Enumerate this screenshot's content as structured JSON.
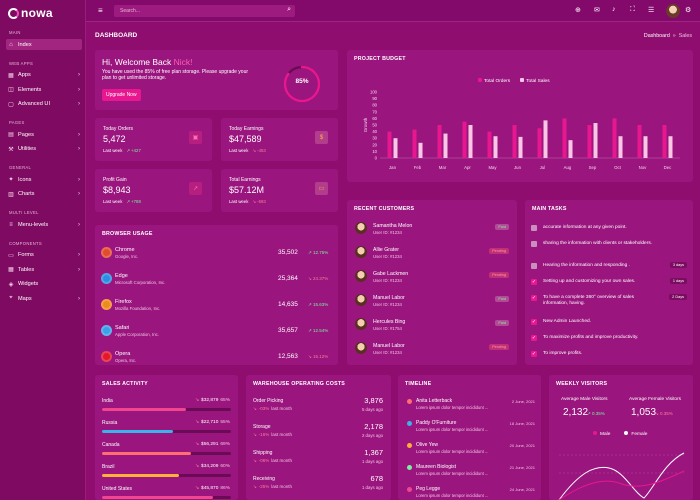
{
  "app": {
    "name": "nowa"
  },
  "sidebar": {
    "sections": [
      {
        "title": "MAIN",
        "items": [
          {
            "label": "Index",
            "icon": "home-icon",
            "chevron": false,
            "active": true
          }
        ]
      },
      {
        "title": "WEB APPS",
        "items": [
          {
            "label": "Apps",
            "icon": "grid-icon",
            "chevron": true
          },
          {
            "label": "Elements",
            "icon": "layers-icon",
            "chevron": true
          },
          {
            "label": "Advanced UI",
            "icon": "box-icon",
            "chevron": true
          }
        ]
      },
      {
        "title": "PAGES",
        "items": [
          {
            "label": "Pages",
            "icon": "pages-icon",
            "chevron": true
          },
          {
            "label": "Utilities",
            "icon": "tools-icon",
            "chevron": true
          }
        ]
      },
      {
        "title": "GENERAL",
        "items": [
          {
            "label": "Icons",
            "icon": "icons-icon",
            "chevron": true
          },
          {
            "label": "Charts",
            "icon": "chart-icon",
            "chevron": true
          }
        ]
      },
      {
        "title": "MULTI LEVEL",
        "items": [
          {
            "label": "Menu-levels",
            "icon": "menu-icon",
            "chevron": true
          }
        ]
      },
      {
        "title": "COMPONENTS",
        "items": [
          {
            "label": "Forms",
            "icon": "forms-icon",
            "chevron": true
          },
          {
            "label": "Tables",
            "icon": "table-icon",
            "chevron": true
          },
          {
            "label": "Widgets",
            "icon": "widget-icon",
            "chevron": false
          },
          {
            "label": "Maps",
            "icon": "map-icon",
            "chevron": true
          }
        ]
      }
    ]
  },
  "header": {
    "search_placeholder": "Search..."
  },
  "page": {
    "title": "DASHBOARD",
    "breadcrumb_home": "Dashboard",
    "breadcrumb_sep": "»",
    "breadcrumb_current": "Sales"
  },
  "welcome": {
    "greeting": "Hi, Welcome Back ",
    "name": "Nick!",
    "text": "You have used the 85% of free plan storage. Please upgrade your plan to get unlimited storage.",
    "button": "Upgrade Now",
    "percent": "85%",
    "percent_value": 85
  },
  "stats": [
    {
      "label": "Today Orders",
      "value": "5,472",
      "period": "Last week",
      "change": "+427",
      "up": true,
      "icon": "orders-icon"
    },
    {
      "label": "Today Earnings",
      "value": "$47,589",
      "period": "Last week",
      "change": "-453",
      "up": false,
      "icon": "earnings-icon"
    },
    {
      "label": "Profit Gain",
      "value": "$8,943",
      "period": "Last week",
      "change": "+788",
      "up": true,
      "icon": "profit-icon"
    },
    {
      "label": "Total Earnings",
      "value": "$57.12M",
      "period": "Last week",
      "change": "-693",
      "up": false,
      "icon": "wallet-icon"
    }
  ],
  "budget": {
    "title": "PROJECT BUDGET",
    "ylabel": "Growth",
    "legend": [
      "Total Orders",
      "Total Sales"
    ],
    "colors": [
      "#e8168f",
      "#f9c6e6"
    ]
  },
  "chart_data": {
    "type": "bar",
    "categories": [
      "Jan",
      "Feb",
      "Mar",
      "Apr",
      "May",
      "Jun",
      "Jul",
      "Aug",
      "Sep",
      "Oct",
      "Nov",
      "Dec"
    ],
    "series": [
      {
        "name": "Total Orders",
        "values": [
          40,
          43,
          50,
          55,
          40,
          50,
          45,
          60,
          50,
          60,
          50,
          50
        ]
      },
      {
        "name": "Total Sales",
        "values": [
          30,
          23,
          37,
          50,
          33,
          32,
          57,
          27,
          53,
          33,
          33,
          33
        ]
      }
    ],
    "ylim": [
      0,
      100
    ],
    "yticks": [
      "0",
      "10",
      "20",
      "30",
      "40",
      "50",
      "60",
      "70",
      "80",
      "90",
      "100"
    ]
  },
  "browser": {
    "title": "BROWSER USAGE",
    "rows": [
      {
        "name": "Chrome",
        "sub": "Google, Inc.",
        "value": "35,502",
        "change": "12.75%",
        "up": true,
        "color": "#e34b2a"
      },
      {
        "name": "Edge",
        "sub": "Microsoft Corporation, Inc.",
        "value": "25,364",
        "change": "24.37%",
        "up": false,
        "color": "#2a8fe3"
      },
      {
        "name": "Firefox",
        "sub": "Mozilla Foundation, Inc.",
        "value": "14,635",
        "change": "15.63%",
        "up": true,
        "color": "#f08a1c"
      },
      {
        "name": "Safari",
        "sub": "Apple Corporation, Inc.",
        "value": "35,657",
        "change": "12.54%",
        "up": true,
        "color": "#3aa0e8"
      },
      {
        "name": "Opera",
        "sub": "Opera, Inc.",
        "value": "12,563",
        "change": "15.12%",
        "up": false,
        "color": "#e3182a"
      }
    ]
  },
  "customers": {
    "title": "RECENT CUSTOMERS",
    "rows": [
      {
        "name": "Samantha Melon",
        "id": "User ID: #1234",
        "status": "Paid",
        "paid": true
      },
      {
        "name": "Allie Grater",
        "id": "User ID: #1234",
        "status": "Pending",
        "paid": false
      },
      {
        "name": "Gabe Lackmen",
        "id": "User ID: #1234",
        "status": "Pending",
        "paid": false
      },
      {
        "name": "Manuel Labor",
        "id": "User ID: #1234",
        "status": "Paid",
        "paid": true
      },
      {
        "name": "Hercules Bing",
        "id": "User ID: #1754",
        "status": "Paid",
        "paid": true
      },
      {
        "name": "Manuel Labor",
        "id": "User ID: #1234",
        "status": "Pending",
        "paid": false
      }
    ]
  },
  "tasks": {
    "title": "MAIN TASKS",
    "rows": [
      {
        "text": "accurate information at any given point.",
        "checked": false,
        "badge": ""
      },
      {
        "text": "sharing the information with clients or stakeholders.",
        "checked": false,
        "badge": ""
      },
      {
        "text": "Hearing the information and responding .",
        "checked": false,
        "badge": "3 days"
      },
      {
        "text": "Setting up and customizing your own sales.",
        "checked": true,
        "badge": "1 days"
      },
      {
        "text": "To have a complete 360° overview of sales information, having.",
        "checked": true,
        "badge": "2 Days"
      },
      {
        "text": "New Admin Launched.",
        "checked": true,
        "badge": ""
      },
      {
        "text": "To maximize profits and improve productivity.",
        "checked": true,
        "badge": ""
      },
      {
        "text": "To improve profits.",
        "checked": true,
        "badge": ""
      }
    ]
  },
  "sales": {
    "title": "SALES ACTIVITY",
    "rows": [
      {
        "country": "India",
        "value": "$32,879",
        "pct": "65%",
        "fill": 0.65,
        "color": "#f1468f"
      },
      {
        "country": "Russia",
        "value": "$22,710",
        "pct": "55%",
        "fill": 0.55,
        "color": "#39b4ea"
      },
      {
        "country": "Canada",
        "value": "$56,291",
        "pct": "69%",
        "fill": 0.69,
        "color": "#ff6f70"
      },
      {
        "country": "Brazil",
        "value": "$34,209",
        "pct": "60%",
        "fill": 0.6,
        "color": "#ffb03b"
      },
      {
        "country": "United States",
        "value": "$45,870",
        "pct": "86%",
        "fill": 0.86,
        "color": "#f1468f"
      }
    ]
  },
  "warehouse": {
    "title": "WAREHOUSE OPERATING COSTS",
    "rows": [
      {
        "name": "Order Picking",
        "value": "3,876",
        "change": "-03%",
        "period": "last month",
        "ago": "5 days ago"
      },
      {
        "name": "Storage",
        "value": "2,178",
        "change": "-16%",
        "period": "last month",
        "ago": "2 days ago"
      },
      {
        "name": "Shipping",
        "value": "1,367",
        "change": "-06%",
        "period": "last month",
        "ago": "1 days ago"
      },
      {
        "name": "Receiving",
        "value": "678",
        "change": "-25%",
        "period": "last month",
        "ago": "1 days ago"
      }
    ]
  },
  "timeline": {
    "title": "TIMELINE",
    "rows": [
      {
        "name": "Anita Letterback",
        "text": "Lorem ipsum dolor tempor incididunt ...",
        "date": "2 June, 2021",
        "color": "#ff6f70"
      },
      {
        "name": "Paddy O'Furniture",
        "text": "Lorem ipsum dolor tempor incididunt ...",
        "date": "18 June, 2021",
        "color": "#39b4ea"
      },
      {
        "name": "Olive Yew",
        "text": "Lorem ipsum dolor tempor incididunt ...",
        "date": "20 June, 2021",
        "color": "#ffb03b"
      },
      {
        "name": "Maureen Biologist",
        "text": "Lorem ipsum dolor tempor incididunt ...",
        "date": "21 June, 2021",
        "color": "#7cf0a0"
      },
      {
        "name": "Peg Legge",
        "text": "Lorem ipsum dolor tempor incididunt ...",
        "date": "24 June, 2021",
        "color": "#f1468f"
      }
    ]
  },
  "visitors": {
    "title": "WEEKLY VISITORS",
    "male_label": "Average Male Visitors",
    "male_value": "2,132",
    "male_change": "0.35%",
    "female_label": "Average Female Visitors",
    "female_value": "1,053",
    "female_change": "0.35%",
    "legend": [
      "Male",
      "Female"
    ]
  }
}
